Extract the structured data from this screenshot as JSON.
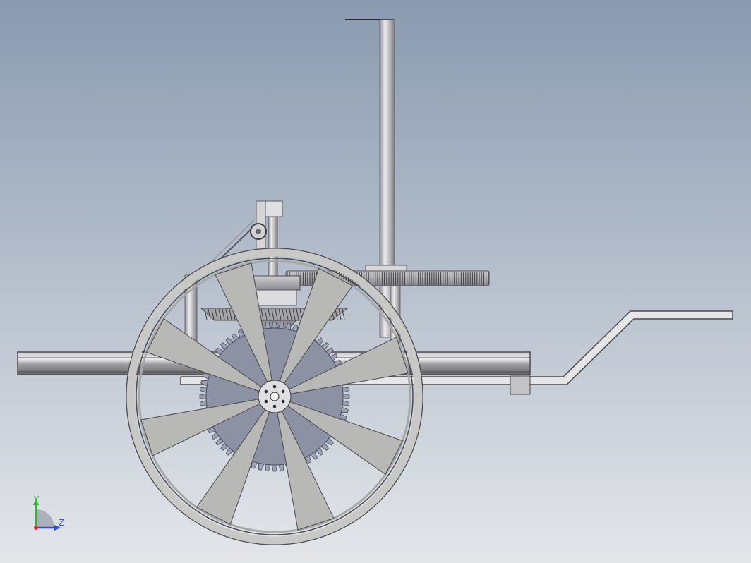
{
  "viewport": {
    "background_top": "#8a9ab0",
    "background_bottom": "#e4e6ea"
  },
  "colors": {
    "metal_light": "#e2e2e4",
    "metal_mid": "#a9a9ad",
    "metal_dark": "#6e6e73",
    "wheel_spoke": "#b8b8b6",
    "gear_blue": "#8d91a4",
    "edge": "#4a4a4e",
    "axis_y": "#2eb82e",
    "axis_z": "#2e4ad8",
    "axis_origin": "#d82e2e"
  },
  "model": {
    "wheel": {
      "spoke_count": 8
    }
  },
  "triad": {
    "y_label": "Y",
    "z_label": "Z"
  }
}
